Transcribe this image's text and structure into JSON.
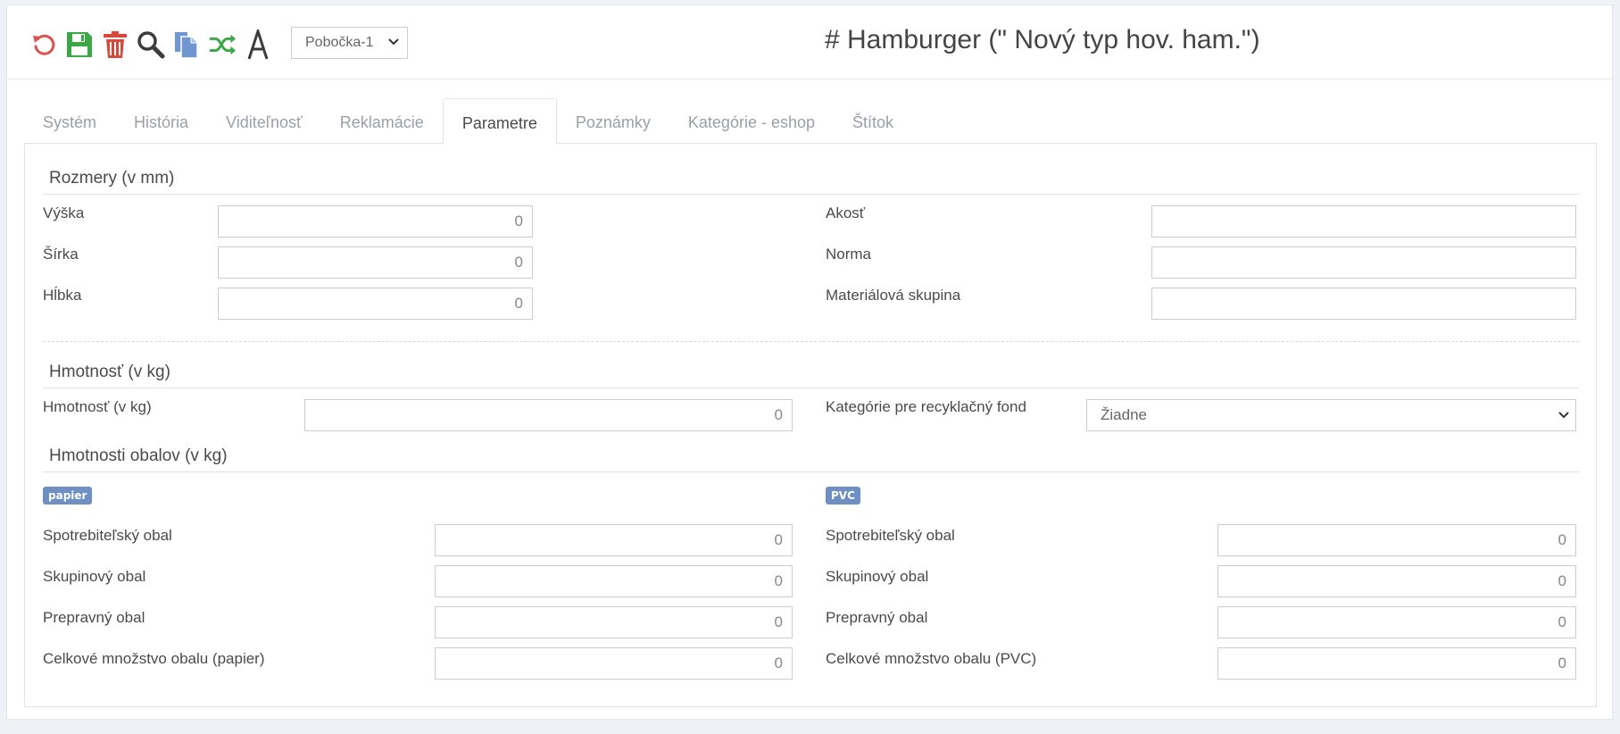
{
  "toolbar": {
    "icons": [
      "refresh-icon",
      "save-icon",
      "trash-icon",
      "search-icon",
      "copy-icon",
      "shuffle-icon",
      "font-icon"
    ],
    "branch": "Pobočka-1"
  },
  "title": "# Hamburger (\" Nový typ hov. ham.\")",
  "tabs": [
    "Systém",
    "História",
    "Viditeľnosť",
    "Reklamácie",
    "Parametre",
    "Poznámky",
    "Kategórie - eshop",
    "Štítok"
  ],
  "active_tab": "Parametre",
  "dimensions": {
    "title": "Rozmery (v mm)",
    "fields": [
      {
        "label": "Výška",
        "value": "0"
      },
      {
        "label": "Šírka",
        "value": "0"
      },
      {
        "label": "Hĺbka",
        "value": "0"
      }
    ],
    "right_fields": [
      {
        "label": "Akosť",
        "value": ""
      },
      {
        "label": "Norma",
        "value": ""
      },
      {
        "label": "Materiálová skupina",
        "value": ""
      }
    ]
  },
  "weight": {
    "title": "Hmotnosť (v kg)",
    "label": "Hmotnosť (v kg)",
    "value": "0",
    "recycle_label": "Kategórie pre recyklačný fond",
    "recycle_value": "Žiadne"
  },
  "packaging": {
    "title": "Hmotnosti obalov (v kg)",
    "paper": {
      "badge": "papier",
      "fields": [
        {
          "label": "Spotrebiteľský obal",
          "value": "0"
        },
        {
          "label": "Skupinový obal",
          "value": "0"
        },
        {
          "label": "Prepravný obal",
          "value": "0"
        },
        {
          "label": "Celkové množstvo obalu (papier)",
          "value": "0"
        }
      ]
    },
    "pvc": {
      "badge": "PVC",
      "fields": [
        {
          "label": "Spotrebiteľský obal",
          "value": "0"
        },
        {
          "label": "Skupinový obal",
          "value": "0"
        },
        {
          "label": "Prepravný obal",
          "value": "0"
        },
        {
          "label": "Celkové množstvo obalu (PVC)",
          "value": "0"
        }
      ]
    }
  },
  "colors": {
    "refresh": "#d9534f",
    "save": "#3aa845",
    "trash": "#d9483b",
    "search": "#3c3c3c",
    "copy": "#6f96d1",
    "shuffle": "#3aa845",
    "badge": "#6e8fc4"
  }
}
